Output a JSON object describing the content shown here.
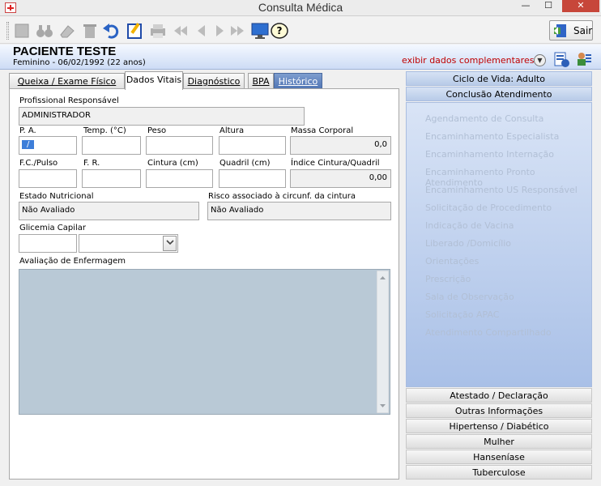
{
  "window": {
    "title": "Consulta Médica",
    "min_glyph": "—",
    "max_glyph": "☐",
    "close_glyph": "✕"
  },
  "toolbar": {
    "sair_label": "Sair",
    "help_glyph": "?"
  },
  "patient": {
    "name": "PACIENTE TESTE",
    "info": "Feminino - 06/02/1992 (22 anos)",
    "exibir_link": "exibir dados complementares...",
    "chev_glyph": "▼"
  },
  "tabs": [
    {
      "label": "Queixa / Exame Físico"
    },
    {
      "label": "Dados Vitais"
    },
    {
      "label": "Diagnóstico"
    },
    {
      "label": "BPA"
    },
    {
      "label": "Histórico"
    }
  ],
  "form": {
    "profissional_label": "Profissional Responsável",
    "profissional_value": "ADMINISTRADOR",
    "pa_label": "P. A.",
    "pa_value": "/",
    "temp_label": "Temp. (°C)",
    "peso_label": "Peso",
    "altura_label": "Altura",
    "massa_label": "Massa Corporal",
    "massa_value": "0,0",
    "fc_label": "F.C./Pulso",
    "fr_label": "F. R.",
    "cintura_label": "Cintura (cm)",
    "quadril_label": "Quadril (cm)",
    "indice_label": "Índice Cintura/Quadril",
    "indice_value": "0,00",
    "estado_label": "Estado Nutricional",
    "estado_value": "Não Avaliado",
    "risco_label": "Risco associado à circunf. da cintura",
    "risco_value": "Não Avaliado",
    "glicemia_label": "Glicemia Capilar",
    "avaliacao_label": "Avaliação de Enfermagem"
  },
  "side": {
    "ciclo": "Ciclo de Vida: Adulto",
    "conclusao": "Conclusão Atendimento",
    "items": [
      "Agendamento de Consulta",
      "Encaminhamento Especialista",
      "Encaminhamento Internação",
      "Encaminhamento Pronto Atendimento",
      "Encaminhamento US Responsável",
      "Solicitação de Procedimento",
      "Indicação de Vacina",
      "Liberado /Domicílio",
      "Orientações",
      "Prescrição",
      "Sala de Observação",
      "Solicitação APAC",
      "Atendimento Compartilhado"
    ],
    "bottom_bars": [
      "Atestado / Declaração",
      "Outras Informações",
      "Hipertenso / Diabético",
      "Mulher",
      "Hanseníase",
      "Tuberculose"
    ]
  }
}
